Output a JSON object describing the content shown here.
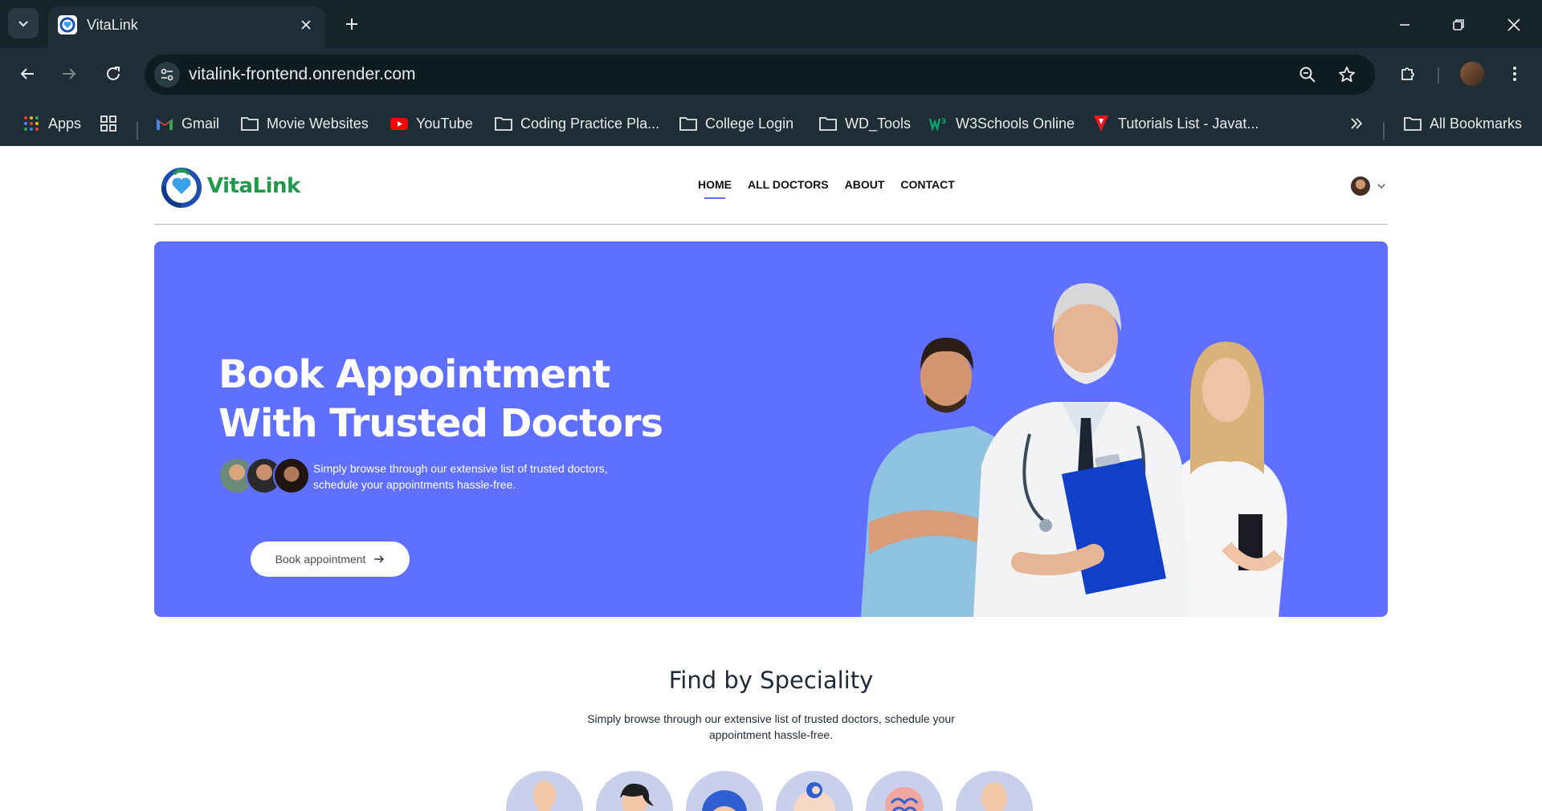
{
  "browser": {
    "tab_title": "VitaLink",
    "url": "vitalink-frontend.onrender.com",
    "bookmarks": [
      {
        "label": "Apps",
        "icon": "apps-grid-icon"
      },
      {
        "label": "",
        "icon": "tab-groups-icon"
      },
      {
        "label": "Gmail",
        "icon": "gmail-icon"
      },
      {
        "label": "Movie Websites",
        "icon": "folder-icon"
      },
      {
        "label": "YouTube",
        "icon": "youtube-icon"
      },
      {
        "label": "Coding Practice Pla...",
        "icon": "folder-icon"
      },
      {
        "label": "College Login",
        "icon": "folder-icon"
      },
      {
        "label": "WD_Tools",
        "icon": "folder-icon"
      },
      {
        "label": "W3Schools Online",
        "icon": "w3schools-icon"
      },
      {
        "label": "Tutorials List - Javat...",
        "icon": "javatpoint-icon"
      }
    ],
    "all_bookmarks_label": "All Bookmarks"
  },
  "site": {
    "brand": "VitaLink",
    "nav": [
      "HOME",
      "ALL DOCTORS",
      "ABOUT",
      "CONTACT"
    ],
    "active_nav": "HOME",
    "colors": {
      "primary": "#5f6fff",
      "brand_green": "#1f9a4a",
      "brand_blue": "#1e4fb0"
    }
  },
  "hero": {
    "title_line1": "Book Appointment",
    "title_line2": "With Trusted Doctors",
    "subtitle_line1": "Simply browse through our extensive list of trusted doctors,",
    "subtitle_line2": "schedule your appointments hassle-free.",
    "cta": "Book appointment",
    "cta_icon": "arrow-right-icon"
  },
  "speciality": {
    "title": "Find by Speciality",
    "subtitle_line1": "Simply browse through our extensive list of trusted doctors, schedule your",
    "subtitle_line2": "appointment hassle-free."
  }
}
